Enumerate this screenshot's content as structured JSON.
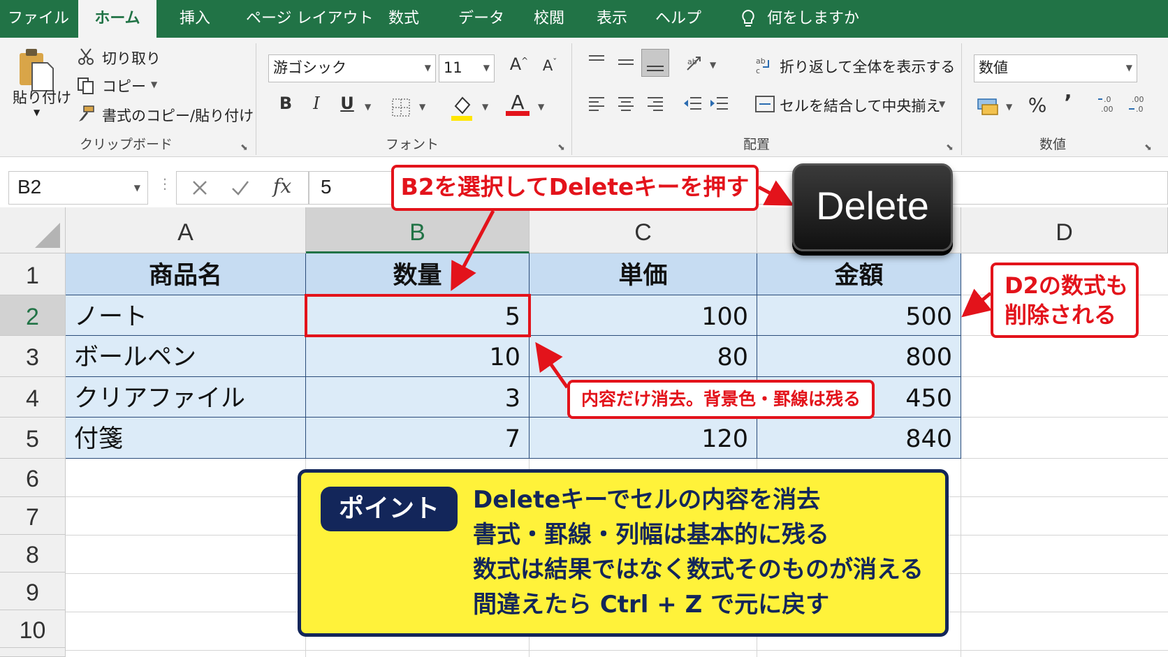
{
  "tabs": [
    {
      "label": "ファイル",
      "active": false
    },
    {
      "label": "ホーム",
      "active": true
    },
    {
      "label": "挿入",
      "active": false
    },
    {
      "label": "ページ レイアウト",
      "active": false
    },
    {
      "label": "数式",
      "active": false
    },
    {
      "label": "データ",
      "active": false
    },
    {
      "label": "校閲",
      "active": false
    },
    {
      "label": "表示",
      "active": false
    },
    {
      "label": "ヘルプ",
      "active": false
    }
  ],
  "tell_me": "何をしますか",
  "ribbon": {
    "clipboard": {
      "paste": "貼り付け",
      "cut": "切り取り",
      "copy": "コピー",
      "format_painter": "書式のコピー/貼り付け",
      "label": "クリップボード"
    },
    "font": {
      "font_name": "游ゴシック",
      "font_size": "11",
      "bold": "B",
      "italic": "I",
      "underline": "U",
      "font_color": "A",
      "label": "フォント"
    },
    "alignment": {
      "wrap_text": "折り返して全体を表示する",
      "merge_center": "セルを結合して中央揃え",
      "label": "配置"
    },
    "number": {
      "format": "数値",
      "percent": "%",
      "comma": "’",
      "label": "数値"
    }
  },
  "formula_bar": {
    "name_box": "B2",
    "fx": "fx",
    "value": "5"
  },
  "columns": [
    "A",
    "B",
    "C",
    "D"
  ],
  "rows": [
    "1",
    "2",
    "3",
    "4",
    "5",
    "6",
    "7",
    "8",
    "9",
    "10"
  ],
  "table": {
    "headers": [
      "商品名",
      "数量",
      "単価",
      "金額"
    ],
    "rows": [
      [
        "ノート",
        "5",
        "100",
        "500"
      ],
      [
        "ボールペン",
        "10",
        "80",
        "800"
      ],
      [
        "クリアファイル",
        "3",
        "",
        "450"
      ],
      [
        "付箋",
        "7",
        "120",
        "840"
      ]
    ]
  },
  "callouts": {
    "select_delete": "B2を選択してDeleteキーを押す",
    "delete_key": "Delete",
    "d2_line1": "D2の数式も",
    "d2_line2": "削除される",
    "content_only": "内容だけ消去。背景色・罫線は残る"
  },
  "point": {
    "badge": "ポイント",
    "lines": [
      "Deleteキーでセルの内容を消去",
      "書式・罫線・列幅は基本的に残る",
      "数式は結果ではなく数式そのものが消える",
      "間違えたら Ctrl + Z で元に戻す"
    ]
  },
  "colors": {
    "excel_green": "#217346",
    "callout_red": "#e3131b",
    "table_fill": "#dcebf8",
    "header_fill": "#c6dcf2",
    "point_yellow": "#fff23a",
    "point_navy": "#13265a"
  }
}
